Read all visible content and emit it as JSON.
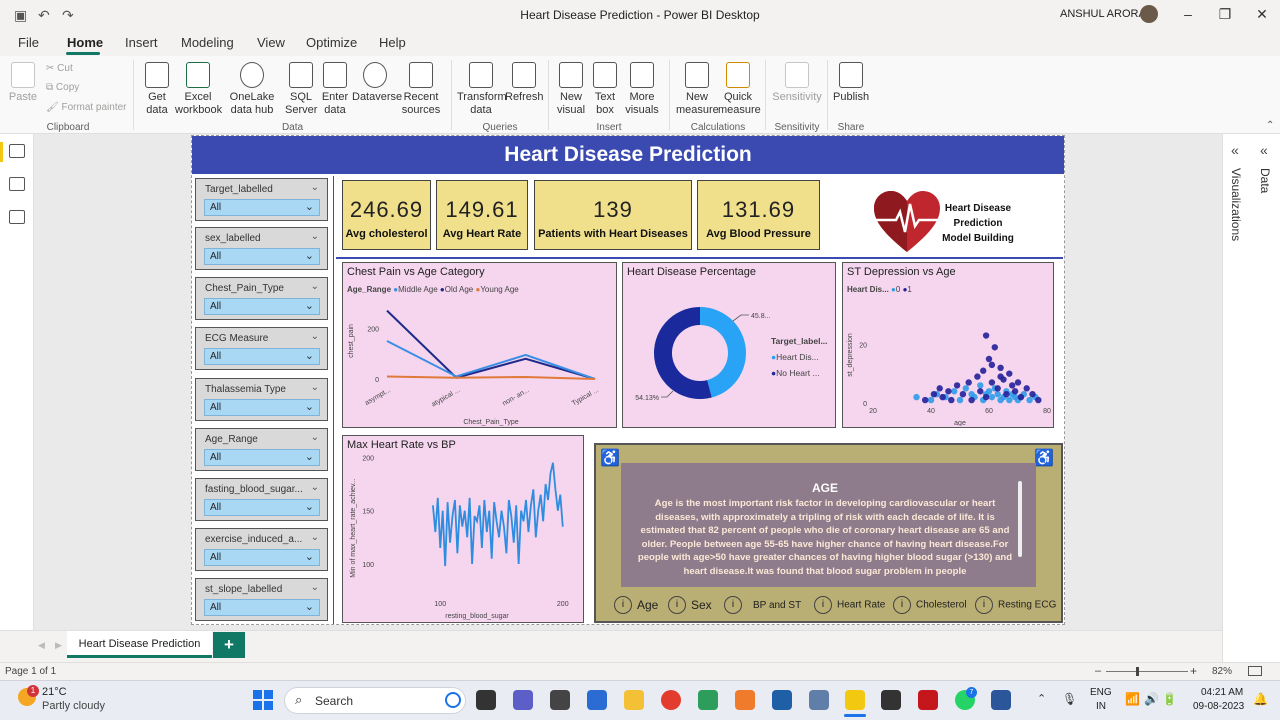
{
  "window": {
    "title": "Heart Disease Prediction - Power BI Desktop",
    "user": "ANSHUL ARORA"
  },
  "menu": {
    "items": [
      "File",
      "Home",
      "Insert",
      "Modeling",
      "View",
      "Optimize",
      "Help"
    ],
    "active": "Home"
  },
  "ribbon": {
    "clipboard": {
      "paste": "Paste",
      "cut": "Cut",
      "copy": "Copy",
      "format_painter": "Format painter",
      "group": "Clipboard"
    },
    "data": {
      "get_data": "Get data",
      "excel": "Excel workbook",
      "onelake": "OneLake data hub",
      "sql": "SQL Server",
      "enter": "Enter data",
      "dataverse": "Dataverse",
      "recent": "Recent sources",
      "group": "Data"
    },
    "queries": {
      "transform": "Transform data",
      "refresh": "Refresh",
      "group": "Queries"
    },
    "insert": {
      "new_visual": "New visual",
      "text_box": "Text box",
      "more_visuals": "More visuals",
      "group": "Insert"
    },
    "calculations": {
      "new_measure": "New measure",
      "quick_measure": "Quick measure",
      "group": "Calculations"
    },
    "sensitivity": {
      "sensitivity": "Sensitivity",
      "group": "Sensitivity"
    },
    "share": {
      "publish": "Publish",
      "group": "Share"
    }
  },
  "report": {
    "banner": "Heart Disease Prediction",
    "slicers": [
      {
        "label": "Target_labelled",
        "value": "All"
      },
      {
        "label": "sex_labelled",
        "value": "All"
      },
      {
        "label": "Chest_Pain_Type",
        "value": "All"
      },
      {
        "label": "ECG Measure",
        "value": "All"
      },
      {
        "label": "Thalassemia Type",
        "value": "All"
      },
      {
        "label": "Age_Range",
        "value": "All"
      },
      {
        "label": "fasting_blood_sugar...",
        "value": "All"
      },
      {
        "label": "exercise_induced_a...",
        "value": "All"
      },
      {
        "label": "st_slope_labelled",
        "value": "All"
      }
    ],
    "kpis": [
      {
        "value": "246.69",
        "label": "Avg cholesterol"
      },
      {
        "value": "149.61",
        "label": "Avg Heart Rate"
      },
      {
        "value": "139",
        "label": "Patients with Heart Diseases"
      },
      {
        "value": "131.69",
        "label": "Avg Blood Pressure"
      }
    ],
    "logo": {
      "line1": "Heart Disease",
      "line2": "Prediction",
      "line3": "Model Building"
    },
    "info": {
      "title": "AGE",
      "body": "Age is the most important risk factor in developing cardiovascular or heart diseases, with approximately a tripling of risk with each decade of life. It is estimated that 82 percent of people who die of coronary heart disease are 65 and older. People between age 55-65 have higher chance of having heart disease.For people with age>50 have greater chances of having higher blood sugar (>130) and heart disease.It was found that blood sugar problem in people",
      "buttons": [
        "Age",
        "Sex",
        "BP and ST",
        "Heart Rate",
        "Cholesterol",
        "Resting ECG"
      ],
      "icon_glyph": "i"
    }
  },
  "chart_data": [
    {
      "type": "line",
      "title": "Chest Pain vs Age Category",
      "legend_title": "Age_Range",
      "legend_labels": [
        "Middle Age",
        "Old Age",
        "Young Age"
      ],
      "categories": [
        "asympt...",
        "atypical ...",
        "non- an...",
        "Typical ..."
      ],
      "xlabel": "Chest_Pain_Type",
      "ylabel": "chest_pain",
      "yticks": [
        "200",
        "0"
      ],
      "ylim": [
        0,
        300
      ],
      "series": [
        {
          "name": "Old Age",
          "color": "#1f2a8a",
          "values": [
            270,
            5,
            80,
            0
          ]
        },
        {
          "name": "Middle Age",
          "color": "#3a8ee6",
          "values": [
            150,
            10,
            95,
            0
          ]
        },
        {
          "name": "Young Age",
          "color": "#e07a3a",
          "values": [
            10,
            5,
            8,
            0
          ]
        }
      ]
    },
    {
      "type": "pie",
      "title": "Heart Disease Percentage",
      "legend_title": "Target_label...",
      "slices": [
        {
          "name": "Heart Dis...",
          "value": 45.87,
          "label": "45.8...",
          "color": "#29a3f5"
        },
        {
          "name": "No Heart ...",
          "value": 54.13,
          "label": "54.13%",
          "color": "#1a2a9c"
        }
      ]
    },
    {
      "type": "scatter",
      "title": "ST Depression vs Age",
      "legend_title": "Heart Dis...",
      "legend_labels": [
        "0",
        "1"
      ],
      "xlabel": "age",
      "ylabel": "st_depression",
      "xticks": [
        "20",
        "40",
        "60",
        "80"
      ],
      "yticks": [
        "20",
        "0"
      ],
      "xlim": [
        20,
        80
      ],
      "ylim": [
        0,
        30
      ],
      "series": [
        {
          "name": "0",
          "color": "#2f9be8",
          "points": [
            [
              35,
              2
            ],
            [
              40,
              1
            ],
            [
              42,
              3
            ],
            [
              45,
              2
            ],
            [
              48,
              4
            ],
            [
              50,
              1
            ],
            [
              52,
              5
            ],
            [
              54,
              3
            ],
            [
              55,
              2
            ],
            [
              57,
              6
            ],
            [
              58,
              1
            ],
            [
              59,
              3
            ],
            [
              60,
              4
            ],
            [
              61,
              2
            ],
            [
              62,
              5
            ],
            [
              63,
              3
            ],
            [
              64,
              1
            ],
            [
              65,
              2
            ],
            [
              66,
              4
            ],
            [
              67,
              1
            ],
            [
              68,
              3
            ],
            [
              69,
              2
            ],
            [
              70,
              1
            ],
            [
              71,
              2
            ],
            [
              72,
              3
            ],
            [
              74,
              1
            ],
            [
              76,
              2
            ]
          ]
        },
        {
          "name": "1",
          "color": "#25209a",
          "points": [
            [
              38,
              1
            ],
            [
              41,
              3
            ],
            [
              43,
              5
            ],
            [
              44,
              2
            ],
            [
              46,
              4
            ],
            [
              47,
              1
            ],
            [
              49,
              6
            ],
            [
              51,
              3
            ],
            [
              53,
              7
            ],
            [
              54,
              1
            ],
            [
              56,
              9
            ],
            [
              57,
              4
            ],
            [
              58,
              11
            ],
            [
              59,
              2
            ],
            [
              60,
              15
            ],
            [
              61,
              7
            ],
            [
              62,
              19
            ],
            [
              63,
              5
            ],
            [
              64,
              12
            ],
            [
              65,
              8
            ],
            [
              66,
              3
            ],
            [
              67,
              10
            ],
            [
              68,
              6
            ],
            [
              69,
              4
            ],
            [
              70,
              7
            ],
            [
              71,
              2
            ],
            [
              73,
              5
            ],
            [
              75,
              3
            ],
            [
              77,
              1
            ],
            [
              59,
              23
            ],
            [
              61,
              13
            ],
            [
              64,
              9
            ]
          ]
        }
      ]
    },
    {
      "type": "line",
      "title": "Max Heart Rate vs BP",
      "xlabel": "resting_blood_sugar",
      "ylabel": "Min of max_heart_rate_achiev...",
      "xticks": [
        "100",
        "200"
      ],
      "yticks": [
        "200",
        "150",
        "100"
      ],
      "xlim": [
        50,
        210
      ],
      "ylim": [
        70,
        205
      ],
      "series": [
        {
          "name": "",
          "color": "#2e8de0",
          "x": [
            94,
            96,
            98,
            100,
            102,
            104,
            106,
            108,
            110,
            112,
            114,
            116,
            118,
            120,
            122,
            124,
            126,
            128,
            130,
            132,
            134,
            136,
            138,
            140,
            142,
            144,
            146,
            148,
            150,
            152,
            154,
            156,
            158,
            160,
            162,
            164,
            166,
            168,
            170,
            172,
            174,
            176,
            178,
            180,
            182,
            184,
            186,
            188,
            190,
            192,
            194,
            196,
            198,
            200
          ],
          "y": [
            155,
            130,
            162,
            115,
            150,
            98,
            158,
            120,
            145,
            160,
            110,
            155,
            135,
            150,
            125,
            162,
            100,
            145,
            140,
            155,
            115,
            160,
            130,
            150,
            105,
            158,
            140,
            125,
            150,
            135,
            110,
            160,
            145,
            120,
            155,
            100,
            150,
            140,
            160,
            130,
            155,
            170,
            125,
            150,
            165,
            140,
            175,
            160,
            185,
            195,
            170,
            150,
            165,
            135
          ]
        }
      ]
    }
  ],
  "panes": {
    "visualizations": "Visualizations",
    "data": "Data"
  },
  "pages": {
    "tab": "Heart Disease Prediction",
    "add": "+"
  },
  "status": {
    "page": "Page 1 of 1",
    "zoom": "82%"
  },
  "taskbar": {
    "temp": "21°C",
    "weather": "Partly cloudy",
    "search": "Search",
    "lang1": "ENG",
    "lang2": "IN",
    "time": "04:21 AM",
    "date": "09-08-2023",
    "badge": "1",
    "badge2": "7"
  }
}
